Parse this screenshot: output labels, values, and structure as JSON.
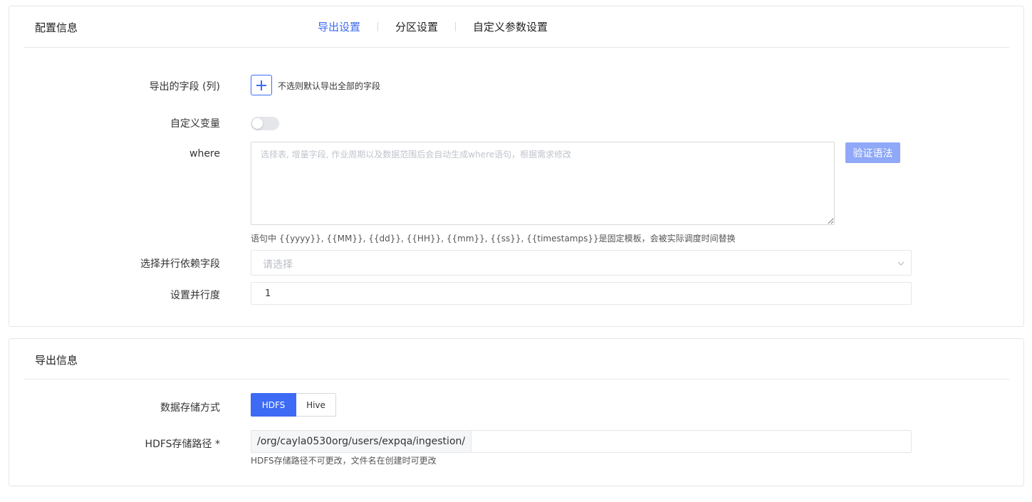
{
  "config_card": {
    "title": "配置信息",
    "tabs": [
      {
        "label": "导出设置",
        "active": true
      },
      {
        "label": "分区设置",
        "active": false
      },
      {
        "label": "自定义参数设置",
        "active": false
      }
    ],
    "fields": {
      "export_columns": {
        "label": "导出的字段 (列)",
        "add_icon": "plus-icon",
        "hint": "不选则默认导出全部的字段"
      },
      "custom_vars": {
        "label": "自定义变量",
        "enabled": false
      },
      "where": {
        "label": "where",
        "placeholder": "选择表, 增量字段, 作业周期以及数据范围后会自动生成where语句，根据需求修改",
        "value": "",
        "verify_label": "验证语法",
        "help": "语句中 {{yyyy}}, {{MM}}, {{dd}}, {{HH}}, {{mm}}, {{ss}}, {{timestamps}}是固定模板，会被实际调度时间替换"
      },
      "parallel_field": {
        "label": "选择并行依赖字段",
        "placeholder": "请选择",
        "arrow_icon": "chevron-down-icon"
      },
      "parallelism": {
        "label": "设置并行度",
        "value": "1"
      }
    }
  },
  "export_card": {
    "title": "导出信息",
    "storage": {
      "label": "数据存储方式",
      "options": [
        "HDFS",
        "Hive"
      ],
      "selected": "HDFS"
    },
    "hdfs_path": {
      "label": "HDFS存储路径 *",
      "prefix": "/org/cayla0530org/users/expqa/ingestion/",
      "value": "",
      "help": "HDFS存储路径不可更改，文件名在创建时可更改"
    }
  },
  "colors": {
    "accent": "#3d6bf5",
    "verify_button": "#8fa8f7",
    "border": "#e4e6eb"
  }
}
